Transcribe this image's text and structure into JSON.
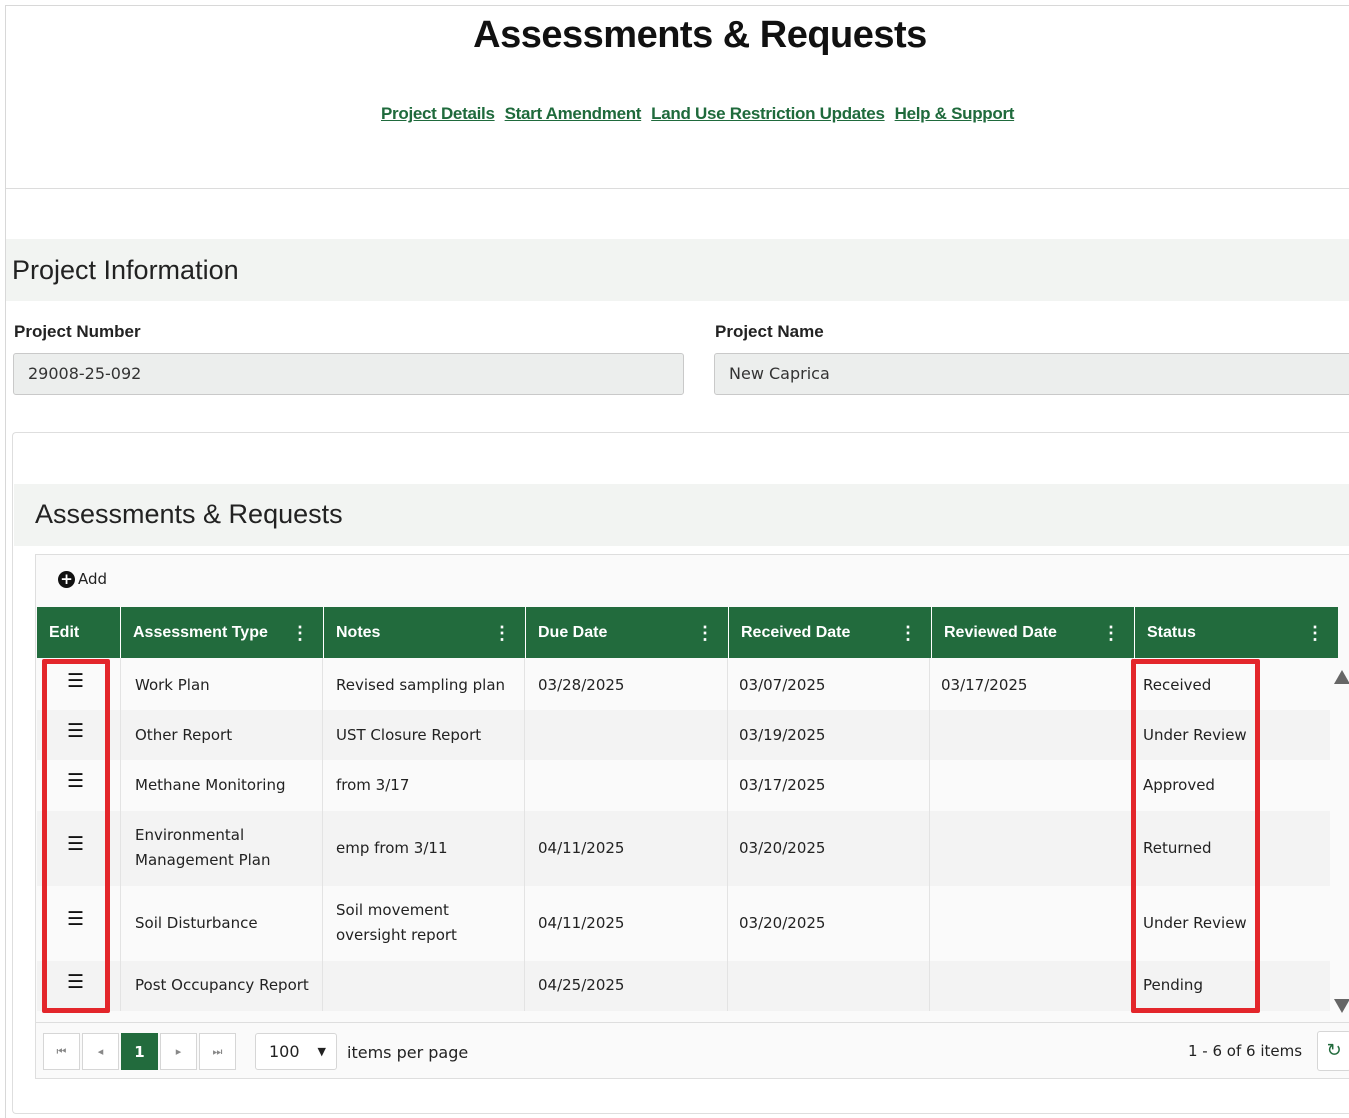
{
  "header": {
    "title": "Assessments & Requests",
    "links": [
      "Project Details",
      "Start Amendment",
      "Land Use Restriction Updates",
      "Help & Support"
    ]
  },
  "project_info": {
    "section_title": "Project Information",
    "number_label": "Project Number",
    "number_value": "29008-25-092",
    "name_label": "Project Name",
    "name_value": "New Caprica"
  },
  "assessments": {
    "section_title": "Assessments & Requests",
    "add_label": "Add",
    "columns": [
      "Edit",
      "Assessment Type",
      "Notes",
      "Due Date",
      "Received Date",
      "Reviewed Date",
      "Status"
    ],
    "rows": [
      {
        "type": [
          "Work Plan"
        ],
        "notes": [
          "Revised sampling plan"
        ],
        "due": "03/28/2025",
        "received": "03/07/2025",
        "reviewed": "03/17/2025",
        "status": "Received"
      },
      {
        "type": [
          "Other Report"
        ],
        "notes": [
          "UST Closure Report"
        ],
        "due": "",
        "received": "03/19/2025",
        "reviewed": "",
        "status": "Under Review"
      },
      {
        "type": [
          "Methane Monitoring"
        ],
        "notes": [
          "from 3/17"
        ],
        "due": "",
        "received": "03/17/2025",
        "reviewed": "",
        "status": "Approved"
      },
      {
        "type": [
          "Environmental",
          "Management Plan"
        ],
        "notes": [
          "emp from 3/11"
        ],
        "due": "04/11/2025",
        "received": "03/20/2025",
        "reviewed": "",
        "status": "Returned"
      },
      {
        "type": [
          "Soil Disturbance"
        ],
        "notes": [
          "Soil movement",
          "oversight report"
        ],
        "due": "04/11/2025",
        "received": "03/20/2025",
        "reviewed": "",
        "status": "Under Review"
      },
      {
        "type": [
          "Post Occupancy Report"
        ],
        "notes": [
          ""
        ],
        "due": "04/25/2025",
        "received": "",
        "reviewed": "",
        "status": "Pending"
      }
    ]
  },
  "pager": {
    "current_page": "1",
    "page_size": "100",
    "items_per_page_label": "items per page",
    "count_text": "1 - 6 of 6 items"
  },
  "colors": {
    "brand_green": "#226b3d",
    "link_green": "#1f6a3c",
    "highlight_red": "#e3262b"
  },
  "icons": {
    "edit": "list-icon",
    "add": "plus-circle-icon",
    "refresh": "refresh-icon",
    "menu": "kebab-icon"
  }
}
